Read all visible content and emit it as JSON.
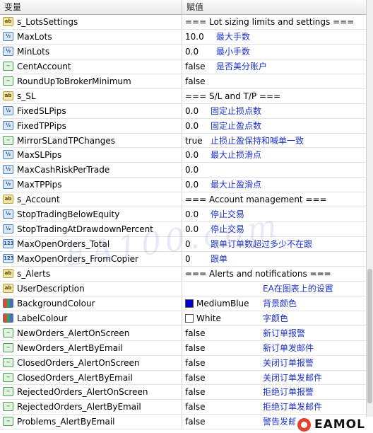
{
  "header": {
    "name_col": "变量",
    "value_col": "赋值"
  },
  "rows": [
    {
      "icon": "ab",
      "name": "s_LotsSettings",
      "value": "=== Lot sizing limits and settings ===",
      "note": ""
    },
    {
      "icon": "dbl",
      "name": "MaxLots",
      "value": "10.0",
      "note": "最大手数"
    },
    {
      "icon": "dbl",
      "name": "MinLots",
      "value": "0.0",
      "note": "最小手数"
    },
    {
      "icon": "bool",
      "name": "CentAccount",
      "value": "false",
      "note": "是否美分账户"
    },
    {
      "icon": "bool",
      "name": "RoundUpToBrokerMinimum",
      "value": "false",
      "note": ""
    },
    {
      "icon": "ab",
      "name": "s_SL",
      "value": "=== S/L and T/P ===",
      "note": ""
    },
    {
      "icon": "dbl",
      "name": "FixedSLPips",
      "value": "0.0",
      "note": "固定止损点数"
    },
    {
      "icon": "dbl",
      "name": "FixedTPPips",
      "value": "0.0",
      "note": "固定止盈点数"
    },
    {
      "icon": "bool",
      "name": "MirrorSLandTPChanges",
      "value": "true",
      "note": "止损止盈保持和喊单一致"
    },
    {
      "icon": "dbl",
      "name": "MaxSLPips",
      "value": "0.0",
      "note": "最大止损滑点"
    },
    {
      "icon": "dbl",
      "name": "MaxCashRiskPerTrade",
      "value": "0.0",
      "note": ""
    },
    {
      "icon": "dbl",
      "name": "MaxTPPips",
      "value": "0.0",
      "note": "最大止盈滑点"
    },
    {
      "icon": "ab",
      "name": "s_Account",
      "value": "=== Account management ===",
      "note": ""
    },
    {
      "icon": "dbl",
      "name": "StopTradingBelowEquity",
      "value": "0.0",
      "note": "停止交易"
    },
    {
      "icon": "dbl",
      "name": "StopTradingAtDrawdownPercent",
      "value": "0.0",
      "note": "停止交易"
    },
    {
      "icon": "num",
      "name": "MaxOpenOrders_Total",
      "value": "0",
      "note": "跟单订单数超过多少不在跟"
    },
    {
      "icon": "num",
      "name": "MaxOpenOrders_FromCopier",
      "value": "0",
      "note": "跟单"
    },
    {
      "icon": "ab",
      "name": "s_Alerts",
      "value": "=== Alerts and notifications ===",
      "note": ""
    },
    {
      "icon": "ab",
      "name": "UserDescription",
      "value": "",
      "note": "EA在图表上的设置"
    },
    {
      "icon": "color",
      "name": "BackgroundColour",
      "value": "MediumBlue",
      "swatch": "#0000cd",
      "note": "背景颜色"
    },
    {
      "icon": "color",
      "name": "LabelColour",
      "value": "White",
      "swatch": "#ffffff",
      "note": "字颜色"
    },
    {
      "icon": "bool",
      "name": "NewOrders_AlertOnScreen",
      "value": "false",
      "note": "新订单报警"
    },
    {
      "icon": "bool",
      "name": "NewOrders_AlertByEmail",
      "value": "false",
      "note": "新订单发邮件"
    },
    {
      "icon": "bool",
      "name": "ClosedOrders_AlertOnScreen",
      "value": "false",
      "note": "关闭订单报警"
    },
    {
      "icon": "bool",
      "name": "ClosedOrders_AlertByEmail",
      "value": "false",
      "note": "关闭订单发邮件"
    },
    {
      "icon": "bool",
      "name": "RejectedOrders_AlertOnScreen",
      "value": "false",
      "note": "拒绝订单报警"
    },
    {
      "icon": "bool",
      "name": "RejectedOrders_AlertByEmail",
      "value": "false",
      "note": "拒绝订单发邮件"
    },
    {
      "icon": "bool",
      "name": "Problems_AlertByEmail",
      "value": "false",
      "note": "警告发邮"
    }
  ],
  "icon_glyphs": {
    "ab": "ab",
    "bool": "~",
    "num": "123",
    "dbl": "½",
    "color": ""
  },
  "watermark": "EA100.com",
  "logo": {
    "text": "EAMOL"
  },
  "colors": {
    "note": "#1d33cc",
    "accent": "#0000cd"
  }
}
